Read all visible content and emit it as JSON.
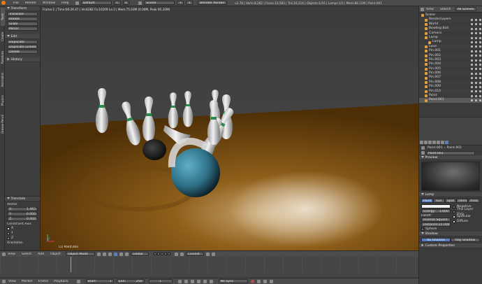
{
  "info_bar": {
    "menus": [
      "File",
      "Render",
      "Window",
      "Help"
    ],
    "screen_layout": "Default",
    "scene": "Scene",
    "engine": "Blender Render",
    "stats": "v2.78 | Verts:8,282 | Faces:10,583 | Tris:16,514 | Objects:1/16 | Lamps:1/3 | Mem:88.21M | Point.001"
  },
  "toolshelf": {
    "transform_header": "Transform",
    "transform_buttons": [
      "Translate",
      "Rotate",
      "Scale",
      "Mirror"
    ],
    "edit_header": "Edit",
    "edit_buttons": [
      "Duplicate",
      "Duplicate Linked",
      "Delete"
    ],
    "history_header": "History",
    "side_tabs": [
      "Tools",
      "Create",
      "Relations",
      "Animation",
      "Physics",
      "Grease Pencil"
    ]
  },
  "operator": {
    "title": "Translate",
    "vector_label": "Vector",
    "x_label": "X:",
    "x_value": "1.493",
    "y_label": "Y:",
    "y_value": "0.000",
    "z_label": "Z:",
    "z_value": "0.000",
    "constraint_label": "Constraint Axis",
    "axis_x": "X",
    "axis_y": "Y",
    "axis_z": "Z",
    "orientation_label": "Orientation"
  },
  "viewport": {
    "header_text": "Frame:1 | Time:00:26.47 | Ve:8282 Fa:10209 La:3 | Mem:75.63M (0.00M, Peak 85.20M)",
    "object_label": "(1) Point.001",
    "toolbar": {
      "view": "View",
      "select": "Select",
      "add": "Add",
      "object": "Object",
      "mode": "Object Mode",
      "pivot": "Global",
      "layer_sel": "Closest"
    }
  },
  "timeline": {
    "view": "View",
    "marker": "Marker",
    "frame": "Frame",
    "playback": "Playback",
    "start_label": "Start:",
    "start_value": "1",
    "end_label": "End:",
    "end_value": "250",
    "current": "1",
    "sync": "No Sync"
  },
  "outliner": {
    "header": {
      "view": "View",
      "search": "Search",
      "filter": "All Scenes"
    },
    "items": [
      {
        "label": "Scene",
        "indent": 0
      },
      {
        "label": "RenderLayers",
        "indent": 1
      },
      {
        "label": "World",
        "indent": 1
      },
      {
        "label": "Bowling Ball",
        "indent": 1
      },
      {
        "label": "Camera",
        "indent": 1
      },
      {
        "label": "Lamp",
        "indent": 1
      },
      {
        "label": "Lamp",
        "indent": 2
      },
      {
        "label": "Lane",
        "indent": 1
      },
      {
        "label": "Pin.001",
        "indent": 1
      },
      {
        "label": "Pin.002",
        "indent": 1
      },
      {
        "label": "Pin.003",
        "indent": 1
      },
      {
        "label": "Pin.004",
        "indent": 1
      },
      {
        "label": "Pin.005",
        "indent": 1
      },
      {
        "label": "Pin.006",
        "indent": 1
      },
      {
        "label": "Pin.007",
        "indent": 1
      },
      {
        "label": "Pin.008",
        "indent": 1
      },
      {
        "label": "Pin.009",
        "indent": 1
      },
      {
        "label": "Pin.010",
        "indent": 1
      },
      {
        "label": "Point",
        "indent": 1
      },
      {
        "label": "Point.001",
        "indent": 1
      }
    ]
  },
  "properties": {
    "breadcrumb": "Point.001",
    "breadcrumb2": "Point.001",
    "name_field": "Point.001",
    "preview_header": "Preview",
    "lamp_header": "Lamp",
    "lamp_types": [
      "Point",
      "Sun",
      "Spot",
      "Hemi",
      "Area"
    ],
    "energy_label": "Energy:",
    "energy_value": "1.000",
    "falloff_label": "Falloff:",
    "falloff_value": "Inverse Square",
    "distance_label": "Distance:",
    "distance_value": "25.000",
    "negative": "Negative",
    "this_layer_only": "This Layer Only",
    "specular": "Specular",
    "diffuse": "Diffuse",
    "sphere": "Sphere",
    "shadow_header": "Shadow",
    "no_shadow": "No Shadow",
    "ray_shadow": "Ray Shadow",
    "custom_properties": "Custom Properties"
  },
  "colors": {
    "accent_blue": "#5680c2",
    "viewport_bg": "#404040",
    "floor": "#8a5a14",
    "ball": "#3f8aa3",
    "timeline_cursor": "#5ad84a"
  }
}
